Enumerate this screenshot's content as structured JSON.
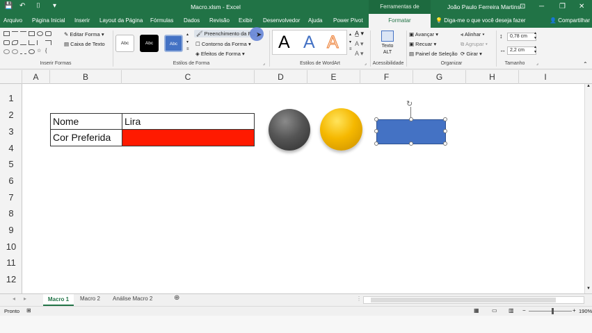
{
  "window": {
    "title": "Macro.xlsm  -  Excel",
    "context_tab_title": "Ferramentas de Desenho",
    "user": "João Paulo Ferreira Martins"
  },
  "tabs": [
    "Arquivo",
    "Página Inicial",
    "Inserir",
    "Layout da Página",
    "Fórmulas",
    "Dados",
    "Revisão",
    "Exibir",
    "Desenvolvedor",
    "Ajuda",
    "Power Pivot"
  ],
  "active_tab": "Formatar",
  "tell_me": "Diga-me o que você deseja fazer",
  "share": "Compartilhar",
  "ribbon": {
    "insert_shapes": {
      "label": "Inserir Formas",
      "edit_shape": "Editar Forma",
      "text_box": "Caixa de Texto"
    },
    "shape_styles": {
      "label": "Estilos de Forma",
      "samples": [
        "Abc",
        "Abc",
        "Abc"
      ],
      "fill": "Preenchimento da F...",
      "outline": "Contorno da Forma",
      "effects": "Efeitos de Forma"
    },
    "wordart": {
      "label": "Estilos de WordArt",
      "letters": [
        "A",
        "A",
        "A"
      ]
    },
    "accessibility": {
      "label": "Acessibilidade",
      "alt_text": "Texto ALT"
    },
    "arrange": {
      "label": "Organizar",
      "bring_forward": "Avançar",
      "send_backward": "Recuar",
      "selection_pane": "Painel de Seleção",
      "align": "Alinhar",
      "group": "Agrupar",
      "rotate": "Girar"
    },
    "size": {
      "label": "Tamanho",
      "height": "0,78 cm",
      "width": "2,2 cm"
    }
  },
  "columns": [
    "A",
    "B",
    "C",
    "D",
    "E",
    "F",
    "G",
    "H",
    "I"
  ],
  "rows": [
    "1",
    "2",
    "3",
    "4",
    "5",
    "6",
    "7",
    "8",
    "9",
    "10",
    "11",
    "12"
  ],
  "cells": {
    "b2": "Nome",
    "c2": "Lira",
    "b3": "Cor Preferida"
  },
  "colors": {
    "excel_green": "#217346",
    "red_fill": "#ff1a00",
    "rect_blue": "#4472c4",
    "ball_gray": "#555555",
    "ball_gold": "#f5b800"
  },
  "sheets": [
    "Macro 1",
    "Macro 2",
    "Análise Macro 2"
  ],
  "active_sheet": "Macro 1",
  "status": {
    "mode": "Pronto",
    "zoom": "190%"
  }
}
